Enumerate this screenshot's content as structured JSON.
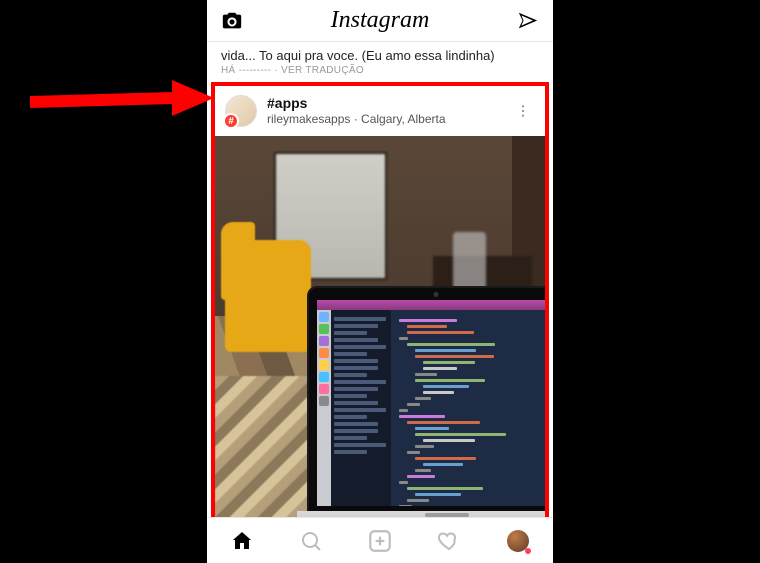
{
  "app": {
    "brand": "Instagram"
  },
  "previous_post": {
    "caption_fragment": "vida... To aqui pra voce. (Eu amo essa lindinha)",
    "meta_fragment": "HÁ --------- · VER TRADUÇÃO"
  },
  "post": {
    "hashtag_title": "#apps",
    "username": "rileymakesapps",
    "separator": " · ",
    "location": "Calgary, Alberta",
    "hash_badge": "#"
  },
  "dock_colors": [
    "#6fb3ff",
    "#57c057",
    "#a470d8",
    "#ff8a4a",
    "#ffcf4a",
    "#4ac0ff",
    "#ff6fa0",
    "#8a8a8a"
  ],
  "code_lines": [
    {
      "indent": 0,
      "w": 38,
      "c": "#c97bdc"
    },
    {
      "indent": 1,
      "w": 26,
      "c": "#d06a4a"
    },
    {
      "indent": 1,
      "w": 44,
      "c": "#d06a4a"
    },
    {
      "indent": 0,
      "w": 6,
      "c": "#888"
    },
    {
      "indent": 1,
      "w": 58,
      "c": "#8fb573"
    },
    {
      "indent": 2,
      "w": 40,
      "c": "#6aa0d0"
    },
    {
      "indent": 2,
      "w": 52,
      "c": "#d06a4a"
    },
    {
      "indent": 3,
      "w": 34,
      "c": "#8fb573"
    },
    {
      "indent": 3,
      "w": 22,
      "c": "#c9c9c9"
    },
    {
      "indent": 2,
      "w": 14,
      "c": "#888"
    },
    {
      "indent": 2,
      "w": 46,
      "c": "#8fb573"
    },
    {
      "indent": 3,
      "w": 30,
      "c": "#6aa0d0"
    },
    {
      "indent": 3,
      "w": 20,
      "c": "#c9c9c9"
    },
    {
      "indent": 2,
      "w": 10,
      "c": "#888"
    },
    {
      "indent": 1,
      "w": 8,
      "c": "#888"
    },
    {
      "indent": 0,
      "w": 6,
      "c": "#888"
    },
    {
      "indent": 0,
      "w": 30,
      "c": "#c97bdc"
    },
    {
      "indent": 1,
      "w": 48,
      "c": "#d06a4a"
    },
    {
      "indent": 2,
      "w": 22,
      "c": "#6aa0d0"
    },
    {
      "indent": 2,
      "w": 60,
      "c": "#8fb573"
    },
    {
      "indent": 3,
      "w": 34,
      "c": "#c9c9c9"
    },
    {
      "indent": 2,
      "w": 12,
      "c": "#888"
    },
    {
      "indent": 1,
      "w": 8,
      "c": "#888"
    },
    {
      "indent": 2,
      "w": 40,
      "c": "#d06a4a"
    },
    {
      "indent": 3,
      "w": 26,
      "c": "#6aa0d0"
    },
    {
      "indent": 2,
      "w": 10,
      "c": "#888"
    },
    {
      "indent": 1,
      "w": 18,
      "c": "#c97bdc"
    },
    {
      "indent": 0,
      "w": 6,
      "c": "#888"
    },
    {
      "indent": 1,
      "w": 50,
      "c": "#8fb573"
    },
    {
      "indent": 2,
      "w": 30,
      "c": "#6aa0d0"
    },
    {
      "indent": 1,
      "w": 14,
      "c": "#888"
    },
    {
      "indent": 0,
      "w": 8,
      "c": "#888"
    }
  ]
}
